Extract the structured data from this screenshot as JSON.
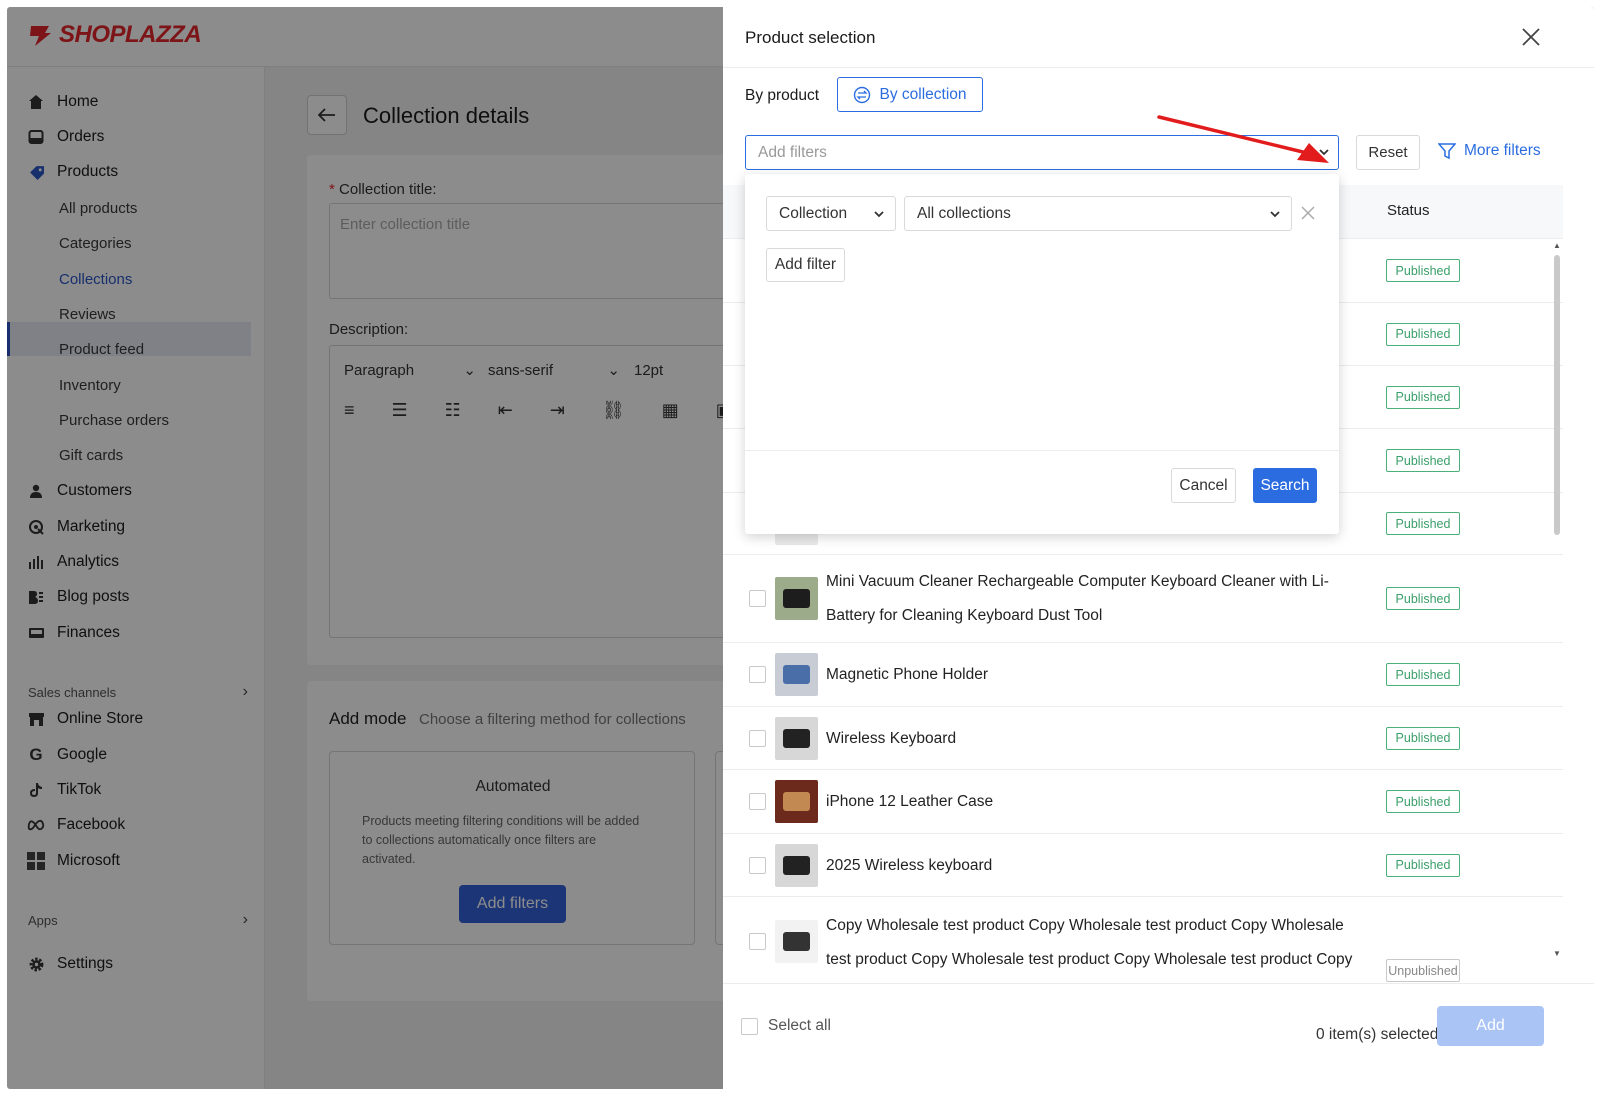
{
  "brand": {
    "name": "SHOPLAZZA",
    "color": "#e3262b"
  },
  "sidebar": {
    "items": [
      {
        "label": "Home",
        "icon": "home-icon"
      },
      {
        "label": "Orders",
        "icon": "inbox-icon"
      },
      {
        "label": "Products",
        "icon": "tag-icon"
      }
    ],
    "product_sub": [
      {
        "label": "All products"
      },
      {
        "label": "Categories"
      },
      {
        "label": "Collections",
        "active": true
      },
      {
        "label": "Reviews"
      },
      {
        "label": "Product feed"
      },
      {
        "label": "Inventory"
      },
      {
        "label": "Purchase orders"
      },
      {
        "label": "Gift cards"
      }
    ],
    "items2": [
      {
        "label": "Customers",
        "icon": "person-icon"
      },
      {
        "label": "Marketing",
        "icon": "megaphone-icon"
      },
      {
        "label": "Analytics",
        "icon": "bar-chart-icon"
      },
      {
        "label": "Blog posts",
        "icon": "blog-icon"
      },
      {
        "label": "Finances",
        "icon": "wallet-icon"
      }
    ],
    "sales_channels_label": "Sales channels",
    "channels": [
      {
        "label": "Online Store",
        "icon": "store-icon"
      },
      {
        "label": "Google",
        "icon": "google-icon"
      },
      {
        "label": "TikTok",
        "icon": "tiktok-icon"
      },
      {
        "label": "Facebook",
        "icon": "meta-icon"
      },
      {
        "label": "Microsoft",
        "icon": "microsoft-icon"
      }
    ],
    "apps_label": "Apps",
    "settings_label": "Settings"
  },
  "page": {
    "title": "Collection details",
    "collection_title_label": "Collection title",
    "collection_title_placeholder": "Enter collection title",
    "description_label": "Description:",
    "editor": {
      "paragraph": "Paragraph",
      "font": "sans-serif",
      "size": "12pt"
    },
    "add_mode_label": "Add mode",
    "add_mode_hint": "Choose a filtering method for collections",
    "automated_title": "Automated",
    "automated_desc": "Products meeting filtering conditions will be added to collections automatically once filters are activated.",
    "add_filters_button": "Add filters"
  },
  "drawer": {
    "title": "Product selection",
    "tab_product": "By product",
    "tab_collection": "By collection",
    "filter_placeholder": "Add filters",
    "reset": "Reset",
    "more_filters": "More filters",
    "status_header": "Status",
    "rows": [
      {
        "name": "",
        "status": "Published",
        "thumb": "none"
      },
      {
        "name": "",
        "status": "Published",
        "thumb": "none"
      },
      {
        "name": "",
        "status": "Published",
        "thumb": "none"
      },
      {
        "name": "",
        "status": "Published",
        "thumb": "none"
      },
      {
        "name": "",
        "status": "Published",
        "thumb": "earbuds"
      },
      {
        "name": "Mini Vacuum Cleaner Rechargeable Computer Keyboard Cleaner with Li-Battery for Cleaning Keyboard Dust Tool",
        "status": "Published",
        "thumb": "vacuum"
      },
      {
        "name": "Magnetic Phone Holder",
        "status": "Published",
        "thumb": "holder"
      },
      {
        "name": "Wireless Keyboard",
        "status": "Published",
        "thumb": "keyboard"
      },
      {
        "name": "iPhone 12 Leather Case",
        "status": "Published",
        "thumb": "cases"
      },
      {
        "name": "2025 Wireless keyboard",
        "status": "Published",
        "thumb": "keyboard"
      },
      {
        "name": "Copy Wholesale test product Copy Wholesale test product Copy Wholesale test product Copy Wholesale test product Copy Wholesale test product Copy",
        "status": "Unpublished",
        "thumb": "tool"
      }
    ],
    "select_all": "Select all",
    "selected_count": "0 item(s) selected",
    "add": "Add",
    "filter_popup": {
      "field": "Collection",
      "value": "All collections",
      "add_filter": "Add filter",
      "cancel": "Cancel",
      "search": "Search"
    },
    "accent_color": "#2b6de0",
    "annotation_arrow_color": "#e21c1c"
  }
}
